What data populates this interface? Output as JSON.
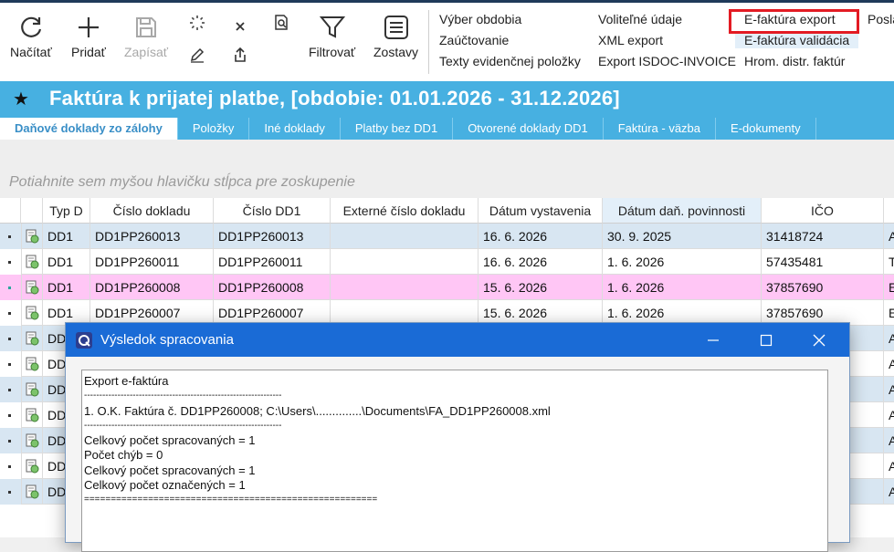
{
  "ribbon": {
    "reload_label": "Načítať",
    "add_label": "Pridať",
    "save_label": "Zapísať",
    "filter_label": "Filtrovať",
    "reports_label": "Zostavy",
    "menu_col1": [
      "Výber obdobia",
      "Zaúčtovanie",
      "Texty evidenčnej položky"
    ],
    "menu_col2": [
      "Voliteľné údaje",
      "XML export",
      "Export ISDOC-INVOICE"
    ],
    "menu_col3": [
      "E-faktúra export",
      "E-faktúra validácia",
      "Hrom. distr. faktúr"
    ],
    "menu_col4_partial": "Posla"
  },
  "window": {
    "title": "Faktúra k prijatej platbe, [obdobie: 01.01.2026 - 31.12.2026]"
  },
  "tabs": [
    "Daňové doklady zo zálohy",
    "Položky",
    "Iné doklady",
    "Platby bez DD1",
    "Otvorené doklady DD1",
    "Faktúra - väzba",
    "E-dokumenty"
  ],
  "grid": {
    "group_hint": "Potiahnite sem myšou hlavičku stĺpca pre zoskupenie",
    "columns": [
      "Typ D",
      "Číslo dokladu",
      "Číslo DD1",
      "Externé číslo dokladu",
      "Dátum vystavenia",
      "Dátum daň. povinnosti",
      "IČO"
    ],
    "rows": [
      {
        "typ": "DD1",
        "cislo": "DD1PP260013",
        "dd1": "DD1PP260013",
        "ext": "",
        "vyst": "16. 6. 2026",
        "dan": "30. 9. 2025",
        "ico": "31418724",
        "extra": "A"
      },
      {
        "typ": "DD1",
        "cislo": "DD1PP260011",
        "dd1": "DD1PP260011",
        "ext": "",
        "vyst": "16. 6. 2026",
        "dan": "1. 6. 2026",
        "ico": "57435481",
        "extra": "T"
      },
      {
        "typ": "DD1",
        "cislo": "DD1PP260008",
        "dd1": "DD1PP260008",
        "ext": "",
        "vyst": "15. 6. 2026",
        "dan": "1. 6. 2026",
        "ico": "37857690",
        "extra": "E"
      },
      {
        "typ": "DD1",
        "cislo": "DD1PP260007",
        "dd1": "DD1PP260007",
        "ext": "",
        "vyst": "15. 6. 2026",
        "dan": "1. 6. 2026",
        "ico": "37857690",
        "extra": "E"
      },
      {
        "typ": "DD",
        "cislo": "",
        "dd1": "",
        "ext": "",
        "vyst": "",
        "dan": "",
        "ico": "",
        "extra": "A"
      },
      {
        "typ": "DD",
        "cislo": "",
        "dd1": "",
        "ext": "",
        "vyst": "",
        "dan": "",
        "ico": "",
        "extra": "A"
      },
      {
        "typ": "DD",
        "cislo": "",
        "dd1": "",
        "ext": "",
        "vyst": "",
        "dan": "",
        "ico": "",
        "extra": "A"
      },
      {
        "typ": "DD",
        "cislo": "",
        "dd1": "",
        "ext": "",
        "vyst": "",
        "dan": "",
        "ico": "",
        "extra": "A"
      },
      {
        "typ": "DD",
        "cislo": "",
        "dd1": "",
        "ext": "",
        "vyst": "",
        "dan": "",
        "ico": "",
        "extra": "A"
      },
      {
        "typ": "DD",
        "cislo": "",
        "dd1": "",
        "ext": "",
        "vyst": "",
        "dan": "",
        "ico": "",
        "extra": "A"
      },
      {
        "typ": "DD",
        "cislo": "",
        "dd1": "",
        "ext": "",
        "vyst": "",
        "dan": "",
        "ico": "",
        "extra": "A"
      }
    ]
  },
  "dialog": {
    "title": "Výsledok spracovania",
    "lines": [
      "Export e-faktúra",
      "-----------------------------------------------------------------",
      "1. O.K. Faktúra č. DD1PP260008; C:\\Users\\..............\\Documents\\FA_DD1PP260008.xml",
      "-----------------------------------------------------------------",
      "Celkový počet spracovaných = 1",
      "Počet chýb  = 0",
      "Celkový počet spracovaných = 1",
      "Celkový počet označených = 1",
      "======================================================="
    ]
  },
  "colors": {
    "accent": "#47b0e1",
    "selected_row": "#ffc6f5",
    "highlight_row": "#d8e6f2",
    "dialog_title": "#1a6bd6",
    "red_box": "#e31b23"
  }
}
